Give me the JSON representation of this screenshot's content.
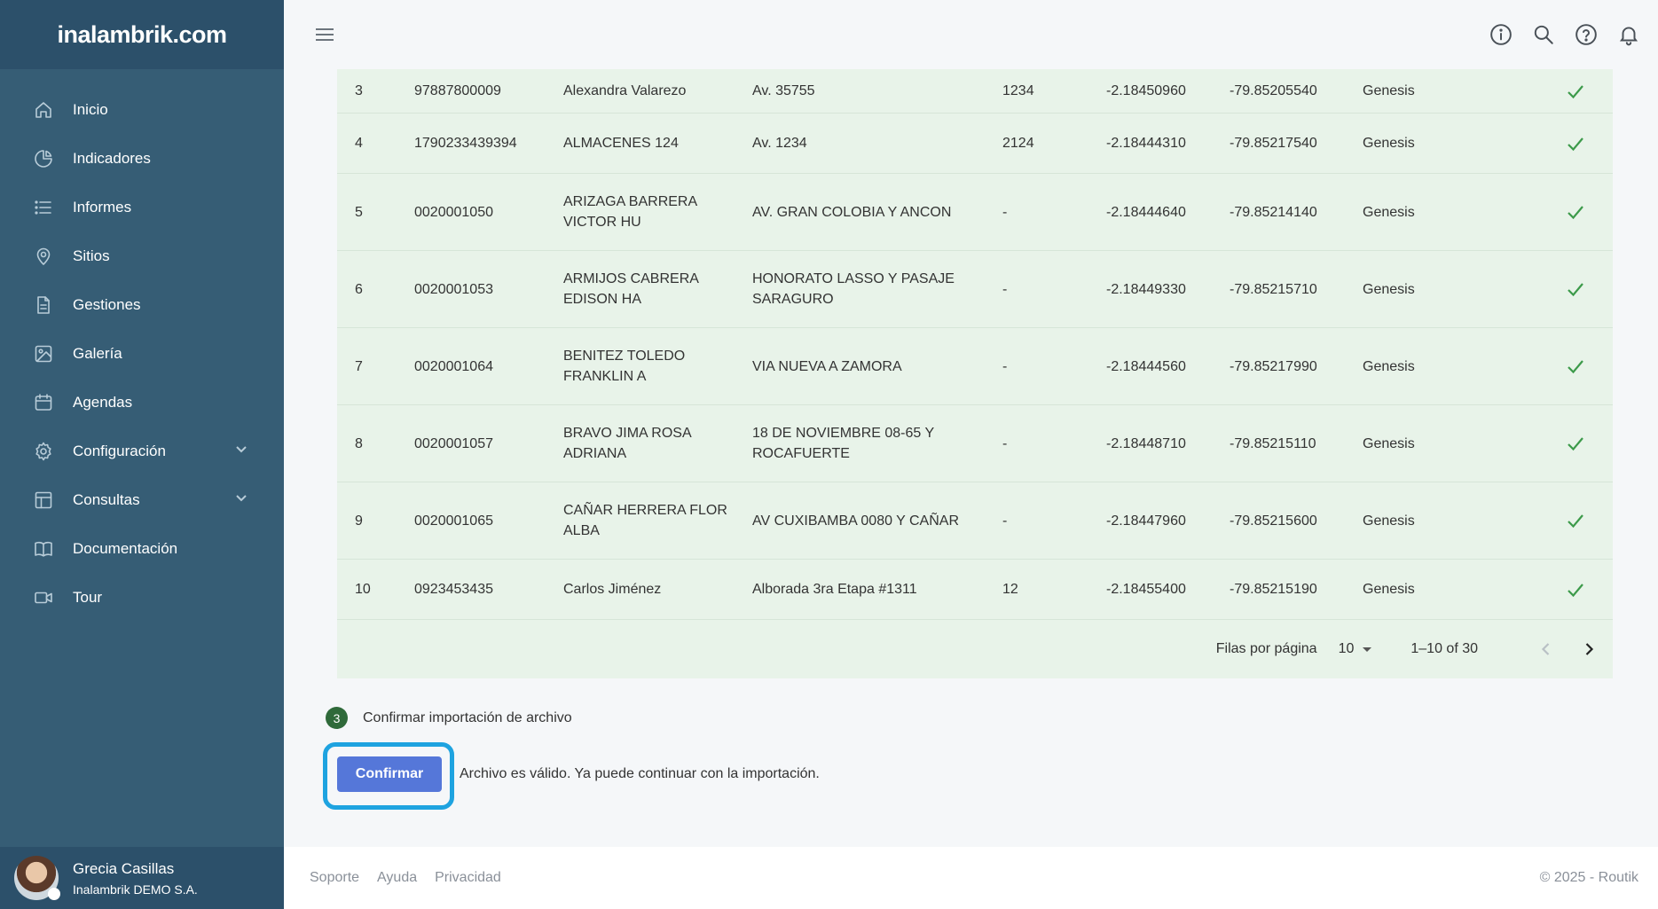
{
  "brand": {
    "logo_text": "inalambrik.com"
  },
  "sidebar": {
    "items": [
      {
        "label": "Inicio",
        "icon": "home-icon"
      },
      {
        "label": "Indicadores",
        "icon": "pie-chart-icon"
      },
      {
        "label": "Informes",
        "icon": "list-icon"
      },
      {
        "label": "Sitios",
        "icon": "map-pin-icon"
      },
      {
        "label": "Gestiones",
        "icon": "document-icon"
      },
      {
        "label": "Galería",
        "icon": "image-icon"
      },
      {
        "label": "Agendas",
        "icon": "calendar-icon"
      },
      {
        "label": "Configuración",
        "icon": "gear-icon"
      },
      {
        "label": "Consultas",
        "icon": "table-icon"
      },
      {
        "label": "Documentación",
        "icon": "book-icon"
      },
      {
        "label": "Tour",
        "icon": "video-icon"
      }
    ]
  },
  "user": {
    "name": "Grecia Casillas",
    "org": "Inalambrik DEMO S.A."
  },
  "table": {
    "rows": [
      {
        "idx": "3",
        "id": "97887800009",
        "name": "Alexandra Valarezo",
        "addr": "Av. 35755",
        "num": "1234",
        "lat": "-2.18450960",
        "lng": "-79.85205540",
        "src": "Genesis"
      },
      {
        "idx": "4",
        "id": "1790233439394",
        "name": "ALMACENES 124",
        "addr": "Av. 1234",
        "num": "2124",
        "lat": "-2.18444310",
        "lng": "-79.85217540",
        "src": "Genesis"
      },
      {
        "idx": "5",
        "id": "0020001050",
        "name": "ARIZAGA BARRERA VICTOR HU",
        "addr": "AV. GRAN COLOBIA Y ANCON",
        "num": "-",
        "lat": "-2.18444640",
        "lng": "-79.85214140",
        "src": "Genesis"
      },
      {
        "idx": "6",
        "id": "0020001053",
        "name": "ARMIJOS CABRERA EDISON HA",
        "addr": "HONORATO LASSO Y PASAJE SARAGURO",
        "num": "-",
        "lat": "-2.18449330",
        "lng": "-79.85215710",
        "src": "Genesis"
      },
      {
        "idx": "7",
        "id": "0020001064",
        "name": "BENITEZ TOLEDO FRANKLIN A",
        "addr": "VIA NUEVA A ZAMORA",
        "num": "-",
        "lat": "-2.18444560",
        "lng": "-79.85217990",
        "src": "Genesis"
      },
      {
        "idx": "8",
        "id": "0020001057",
        "name": "BRAVO JIMA ROSA ADRIANA",
        "addr": "18 DE NOVIEMBRE 08-65 Y ROCAFUERTE",
        "num": "-",
        "lat": "-2.18448710",
        "lng": "-79.85215110",
        "src": "Genesis"
      },
      {
        "idx": "9",
        "id": "0020001065",
        "name": "CAÑAR HERRERA FLOR ALBA",
        "addr": "AV CUXIBAMBA 0080 Y CAÑAR",
        "num": "-",
        "lat": "-2.18447960",
        "lng": "-79.85215600",
        "src": "Genesis"
      },
      {
        "idx": "10",
        "id": "0923453435",
        "name": "Carlos Jiménez",
        "addr": "Alborada 3ra Etapa #1311",
        "num": "12",
        "lat": "-2.18455400",
        "lng": "-79.85215190",
        "src": "Genesis"
      }
    ]
  },
  "pager": {
    "rows_per_page_label": "Filas por página",
    "rows_per_page": "10",
    "range": "1–10 of 30"
  },
  "step": {
    "number": "3",
    "label": "Confirmar importación de archivo"
  },
  "confirm": {
    "button": "Confirmar",
    "message": "Archivo es válido. Ya puede continuar con la importación."
  },
  "footer": {
    "links": [
      "Soporte",
      "Ayuda",
      "Privacidad"
    ],
    "copyright": "© 2025 - Routik"
  },
  "colors": {
    "sidebar": "#365d75",
    "table_bg": "#e8f3e9",
    "accent": "#5577d9",
    "highlight": "#1ea3e0",
    "check": "#3c9a4a"
  }
}
